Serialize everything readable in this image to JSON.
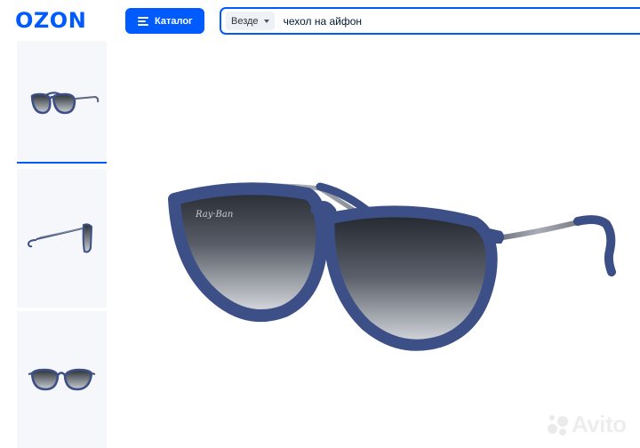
{
  "header": {
    "logo": "OZON",
    "catalog_label": "Каталог",
    "search": {
      "scope_label": "Везде",
      "value": "чехол на айфон"
    }
  },
  "gallery": {
    "thumbnails": [
      {
        "view": "three-quarter",
        "selected": true
      },
      {
        "view": "side",
        "selected": false
      },
      {
        "view": "front",
        "selected": false
      }
    ],
    "main_image": {
      "subject": "sunglasses",
      "frame_color": "#3c4f86",
      "lens_gradient": [
        "#2b3037",
        "#cfd3d8"
      ]
    }
  },
  "watermark": "Avito",
  "colors": {
    "accent": "#005bff",
    "thumb_bg": "#f5f7fa"
  }
}
